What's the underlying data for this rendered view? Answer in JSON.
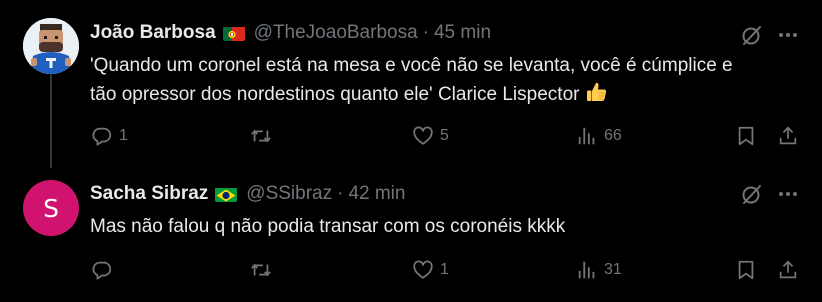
{
  "posts": [
    {
      "name": "João Barbosa",
      "flag": "portugal-flag",
      "handle": "@TheJoaoBarbosa",
      "separator": "·",
      "time": "45 min",
      "text_line1": "'Quando um coronel está na mesa e você não se levanta, você é cúmplice e",
      "text_line2": "tão opressor dos nordestinos quanto ele' Clarice Lispector",
      "emoji": "thumbs-up",
      "replies": "1",
      "reposts": "",
      "likes": "5",
      "views": "66"
    },
    {
      "name": "Sacha Sibraz",
      "flag": "brazil-flag",
      "avatar_letter": "S",
      "avatar_color": "#d0136e",
      "handle": "@SSibraz",
      "separator": "·",
      "time": "42 min",
      "text_line1": "Mas não falou q não podia transar com os coronéis kkkk",
      "replies": "",
      "reposts": "",
      "likes": "1",
      "views": "31"
    }
  ],
  "colors": {
    "background": "#000000",
    "text": "#e7e9ea",
    "secondary": "#71767b",
    "thread_line": "#333639"
  }
}
